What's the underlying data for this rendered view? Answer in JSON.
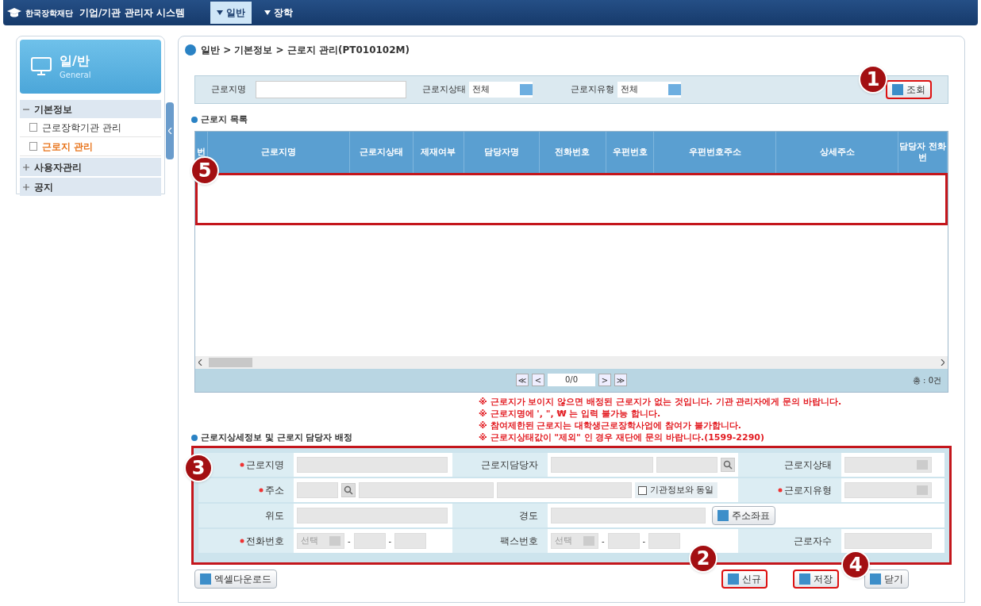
{
  "header": {
    "logo_text": "한국장학재단",
    "system_title": "기업/기관 관리자 시스템",
    "menu": [
      {
        "label": "일반",
        "selected": true
      },
      {
        "label": "장학",
        "selected": false
      }
    ]
  },
  "sidebar": {
    "title": "일/반",
    "subtitle": "General",
    "groups": [
      {
        "label": "기본정보",
        "expanded": true,
        "children": [
          {
            "label": "근로장학기관 관리",
            "selected": false
          },
          {
            "label": "근로지 관리",
            "selected": true
          }
        ]
      },
      {
        "label": "사용자관리",
        "expanded": false
      },
      {
        "label": "공지",
        "expanded": false
      }
    ]
  },
  "breadcrumb": "일반 > 기본정보 > 근로지 관리(PT010102M)",
  "search": {
    "name_label": "근로지명",
    "status_label": "근로지상태",
    "status_value": "전체",
    "type_label": "근로지유형",
    "type_value": "전체",
    "button": "조회"
  },
  "list": {
    "title": "근로지 목록",
    "columns": [
      "번",
      "근로지명",
      "근로지상태",
      "제재여부",
      "담당자명",
      "전화번호",
      "우편번호",
      "우편번호주소",
      "상세주소",
      "담당자 전화번"
    ],
    "pager": {
      "first": "≪",
      "prev": "<",
      "page": "0/0",
      "next": ">",
      "last": "≫"
    },
    "total": "총 : 0건"
  },
  "notices": [
    "※ 근로지가 보이지 않으면 배정된 근로지가 없는 것입니다. 기관 관리자에게 문의 바랍니다.",
    "※ 근로지명에 ', \", ₩ 는 입력 불가능 합니다.",
    "※ 참여제한된 근로지는 대학생근로장학사업에 참여가 불가합니다.",
    "※ 근로지상태값이 \"제외\" 인 경우 재단에 문의 바랍니다.(1599-2290)"
  ],
  "detail": {
    "title": "근로지상세정보 및 근로지 담당자 배정",
    "labels": [
      {
        "text": "근로지명",
        "required": true
      },
      {
        "text": "근로지담당자",
        "required": false
      },
      {
        "text": "근로지상태",
        "required": false
      },
      {
        "text": "주소",
        "required": true
      },
      {
        "text": "근로지유형",
        "required": true
      },
      {
        "text": "위도",
        "required": false
      },
      {
        "text": "경도",
        "required": false
      },
      {
        "text": "전화번호",
        "required": true
      },
      {
        "text": "팩스번호",
        "required": false
      },
      {
        "text": "근로자수",
        "required": false
      }
    ],
    "same_as_org": {
      "label": "기관정보와 동일",
      "checked": false
    },
    "coord_button": "주소좌표",
    "separator": "-",
    "phone_placeholder": "선택",
    "fax_placeholder": "선택"
  },
  "buttons_left": [
    "엑셀다운로드"
  ],
  "buttons_right": [
    "신규",
    "저장",
    "닫기"
  ],
  "annotations": [
    "1",
    "5",
    "3",
    "2",
    "4"
  ]
}
